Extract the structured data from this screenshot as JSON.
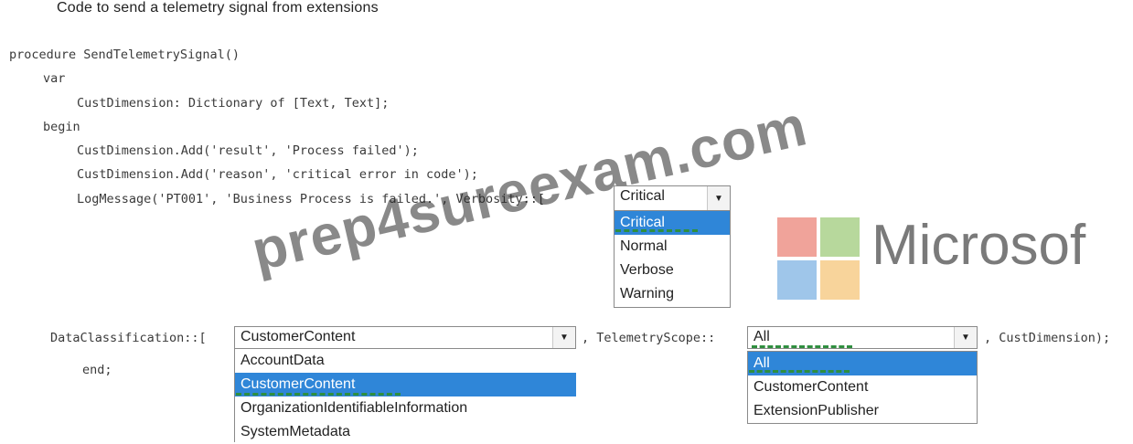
{
  "heading": "Code to send a telemetry signal from extensions",
  "code": {
    "line1": "procedure SendTelemetrySignal()",
    "line2": "var",
    "line3": "CustDimension: Dictionary of [Text, Text];",
    "line4": "begin",
    "line5": "CustDimension.Add('result', 'Process failed');",
    "line6": "CustDimension.Add('reason', 'critical error in code');",
    "line7": "LogMessage('PT001', 'Business Process is failed.', Verbosity::[",
    "line8a": "DataClassification::[",
    "line8b": ", TelemetryScope::",
    "line8c": ", CustDimension);",
    "line9": "end;"
  },
  "verbosity": {
    "selected": "Critical",
    "options": [
      "Critical",
      "Normal",
      "Verbose",
      "Warning"
    ]
  },
  "data_classification": {
    "selected": "CustomerContent",
    "options": [
      "AccountData",
      "CustomerContent",
      "OrganizationIdentifiableInformation",
      "SystemMetadata"
    ]
  },
  "telemetry_scope": {
    "selected": "All",
    "options": [
      "All",
      "CustomerContent",
      "ExtensionPublisher"
    ]
  },
  "watermark": "prep4sureexam.com",
  "logo_text": "Microsof",
  "colors": {
    "selection": "#2f86d8",
    "answer_dash": "#2f8f3f",
    "logo_red": "#f0a39a",
    "logo_green": "#b7d89c",
    "logo_blue": "#9fc6ea",
    "logo_yellow": "#f8d49b"
  }
}
